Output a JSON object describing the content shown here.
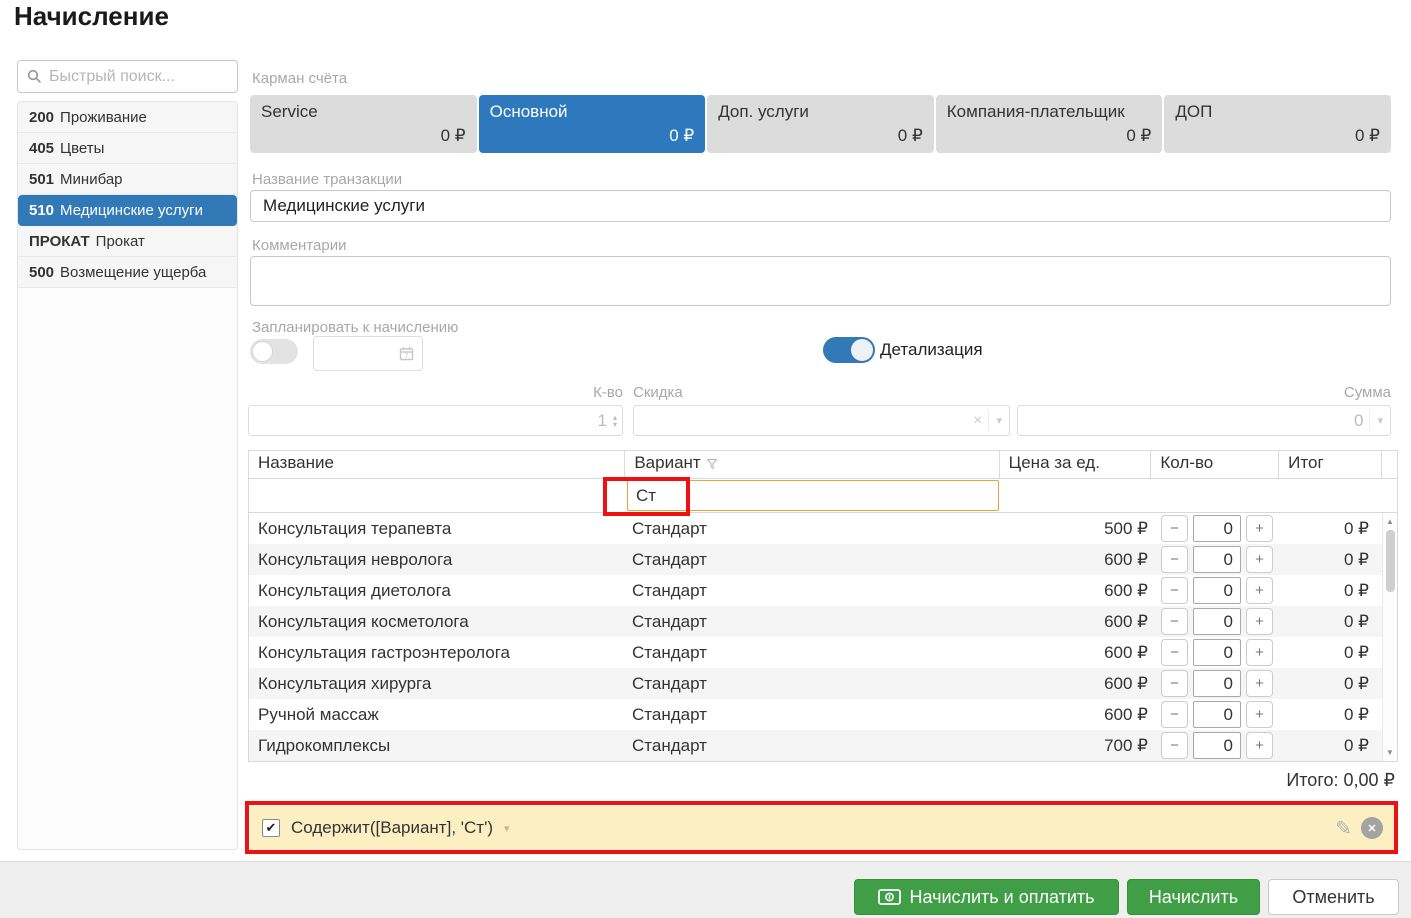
{
  "page": {
    "title": "Начисление"
  },
  "sidebar": {
    "search_placeholder": "Быстрый поиск...",
    "items": [
      {
        "code": "200",
        "label": "Проживание",
        "selected": false
      },
      {
        "code": "405",
        "label": "Цветы",
        "selected": false
      },
      {
        "code": "501",
        "label": "Минибар",
        "selected": false
      },
      {
        "code": "510",
        "label": "Медицинские услуги",
        "selected": true
      },
      {
        "code": "ПРОКАТ",
        "label": "Прокат",
        "selected": false
      },
      {
        "code": "500",
        "label": "Возмещение ущерба",
        "selected": false
      }
    ]
  },
  "pockets": {
    "label": "Карман счёта",
    "tabs": [
      {
        "name": "Service",
        "amount": "0 ₽",
        "active": false
      },
      {
        "name": "Основной",
        "amount": "0 ₽",
        "active": true
      },
      {
        "name": "Доп. услуги",
        "amount": "0 ₽",
        "active": false
      },
      {
        "name": "Компания-плательщик",
        "amount": "0 ₽",
        "active": false
      },
      {
        "name": "ДОП",
        "amount": "0 ₽",
        "active": false
      }
    ]
  },
  "form": {
    "transaction_label": "Название транзакции",
    "transaction_value": "Медицинские услуги",
    "comments_label": "Комментарии",
    "comments_value": "",
    "schedule_label": "Запланировать к начислению",
    "schedule_on": false,
    "schedule_date_value": "",
    "details_label": "Детализация",
    "details_on": true,
    "qty_label": "К-во",
    "qty_value": "1",
    "discount_label": "Скидка",
    "discount_value": "",
    "sum_label": "Сумма",
    "sum_value": "0"
  },
  "table": {
    "headers": {
      "name": "Название",
      "variant": "Вариант",
      "price": "Цена за ед.",
      "qty": "Кол-во",
      "total": "Итог"
    },
    "filter_value": "Ст",
    "minus": "−",
    "plus": "+",
    "rows": [
      {
        "name": "Консультация терапевта",
        "variant": "Стандарт",
        "price": "500 ₽",
        "qty": "0",
        "total": "0 ₽"
      },
      {
        "name": "Консультация невролога",
        "variant": "Стандарт",
        "price": "600 ₽",
        "qty": "0",
        "total": "0 ₽"
      },
      {
        "name": "Консультация диетолога",
        "variant": "Стандарт",
        "price": "600 ₽",
        "qty": "0",
        "total": "0 ₽"
      },
      {
        "name": "Консультация косметолога",
        "variant": "Стандарт",
        "price": "600 ₽",
        "qty": "0",
        "total": "0 ₽"
      },
      {
        "name": "Консультация гастроэнтеролога",
        "variant": "Стандарт",
        "price": "600 ₽",
        "qty": "0",
        "total": "0 ₽"
      },
      {
        "name": "Консультация хирурга",
        "variant": "Стандарт",
        "price": "600 ₽",
        "qty": "0",
        "total": "0 ₽"
      },
      {
        "name": "Ручной массаж",
        "variant": "Стандарт",
        "price": "600 ₽",
        "qty": "0",
        "total": "0 ₽"
      },
      {
        "name": "Гидрокомплексы",
        "variant": "Стандарт",
        "price": "700 ₽",
        "qty": "0",
        "total": "0 ₽"
      }
    ],
    "total_line": "Итого: 0,00 ₽"
  },
  "filter_bar": {
    "checked": true,
    "check_glyph": "✔",
    "expression": "Содержит([Вариант], 'Ст')"
  },
  "footer": {
    "pay_and_charge": "Начислить и оплатить",
    "charge": "Начислить",
    "cancel": "Отменить"
  },
  "icons": {
    "caret_down": "▾",
    "spin_up": "▴",
    "spin_down": "▾",
    "scroll_up": "▲",
    "scroll_down": "▼",
    "clear": "×",
    "pencil": "✎",
    "close": "✕"
  },
  "colors": {
    "accent_blue": "#3279b7",
    "tab_active_blue": "#2e79bd",
    "button_green": "#3f9e46",
    "highlight_yellow": "#fcf0c3",
    "annotation_red": "#ee1111",
    "filter_border_orange": "#e8a33d"
  }
}
